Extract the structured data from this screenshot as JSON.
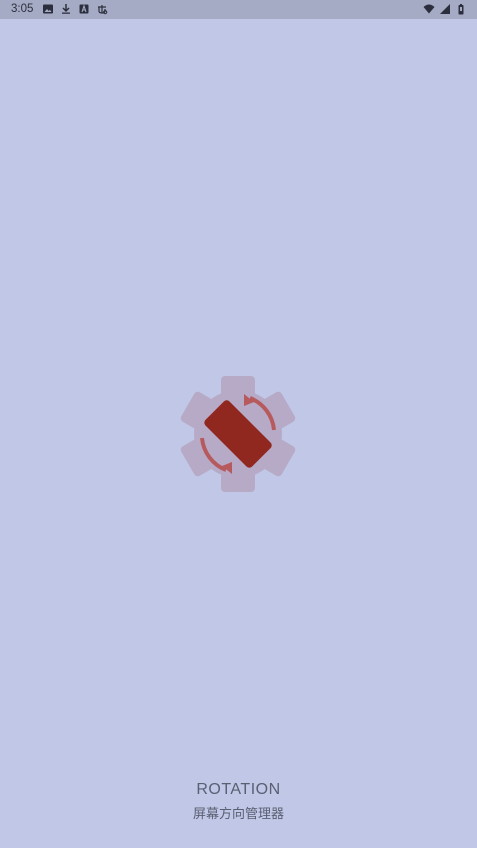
{
  "status_bar": {
    "time": "3:05",
    "left_icons": [
      "image-icon",
      "download-icon",
      "a-box-icon",
      "debug-bug-icon"
    ],
    "right_icons": [
      "wifi-icon",
      "cellular-signal-icon",
      "battery-icon"
    ]
  },
  "splash": {
    "logo": "rotation-gear-icon",
    "app_name": "ROTATION",
    "subtitle": "屏幕方向管理器"
  },
  "colors": {
    "background": "#c1c7e6",
    "status_bar": "#a6abc5",
    "gear": "#b7aac7",
    "device": "#902820",
    "arrows": "#b65a5d",
    "text": "#5a6072"
  }
}
